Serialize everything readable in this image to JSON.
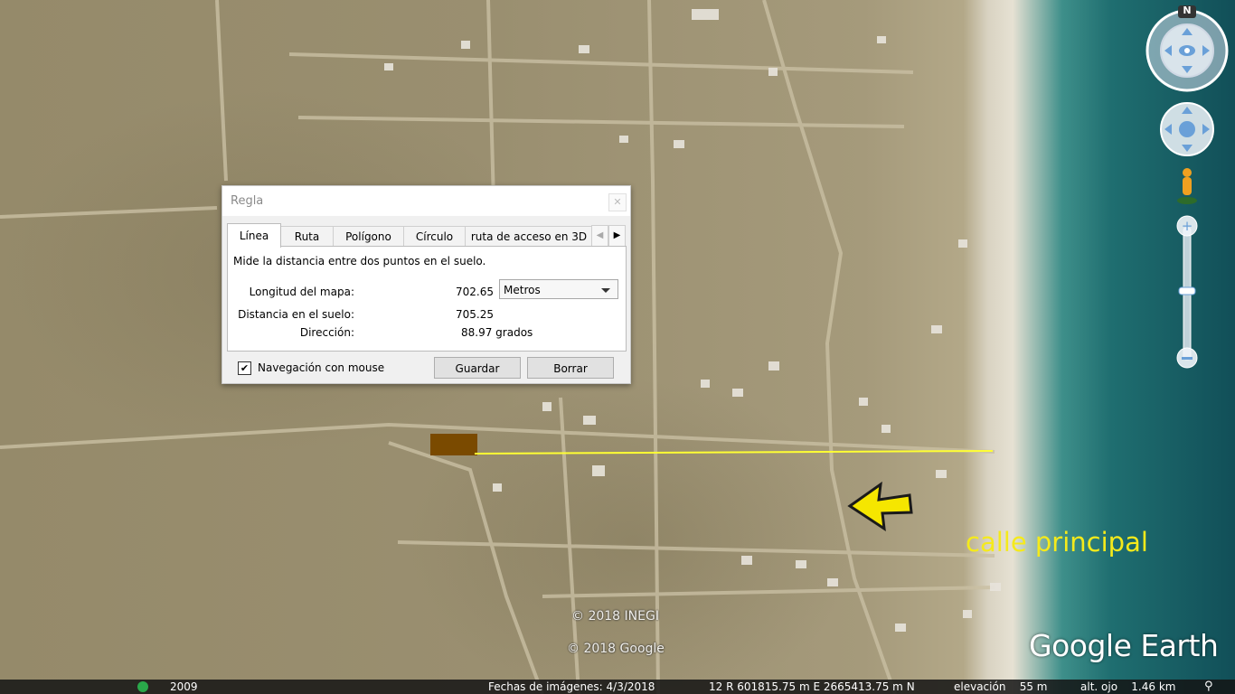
{
  "dialog": {
    "title": "Regla",
    "tabs": [
      "Línea",
      "Ruta",
      "Polígono",
      "Círculo",
      "ruta de acceso en 3D"
    ],
    "active_tab": "Línea",
    "description": "Mide la distancia entre dos puntos en el suelo.",
    "map_length_label": "Longitud del mapa:",
    "map_length_value": "702.65",
    "unit_selected": "Metros",
    "ground_distance_label": "Distancia en el suelo:",
    "ground_distance_value": "705.25",
    "direction_label": "Dirección:",
    "direction_value": "88.97 grados",
    "mouse_nav_label": "Navegación con mouse",
    "mouse_nav_checked": true,
    "save_label": "Guardar",
    "clear_label": "Borrar"
  },
  "map": {
    "annotation_text": "calle principal",
    "annotation_color": "#f5ea1b",
    "measure_line_color": "#ffff33",
    "parcel_color": "#7a4a00",
    "copyright_inegi": "© 2018 INEGI",
    "copyright_google": "© 2018 Google",
    "logo_text": "Google Earth"
  },
  "navigation": {
    "compass_north": "N"
  },
  "statusbar": {
    "historical_year": "2009",
    "imagery_date": "Fechas de imágenes: 4/3/2018",
    "coordinates": "12 R 601815.75 m E 2665413.75 m N",
    "elevation": "elevación    55 m",
    "eye_altitude": "alt. ojo    1.46 km"
  }
}
